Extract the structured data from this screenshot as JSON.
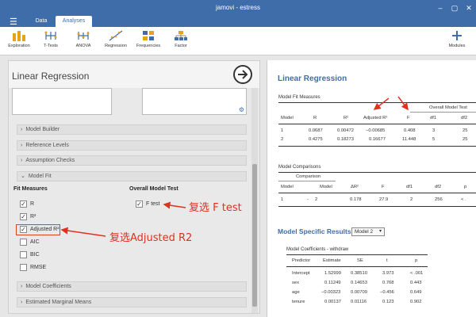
{
  "window": {
    "title": "jamovi - estress"
  },
  "ribbon": {
    "tabs": [
      "Data",
      "Analyses"
    ],
    "tools": [
      {
        "label": "Exploration",
        "icon": "exploration-icon"
      },
      {
        "label": "T-Tests",
        "icon": "t-tests-icon"
      },
      {
        "label": "ANOVA",
        "icon": "anova-icon"
      },
      {
        "label": "Regression",
        "icon": "regression-icon"
      },
      {
        "label": "Frequencies",
        "icon": "frequencies-icon"
      },
      {
        "label": "Factor",
        "icon": "factor-icon"
      }
    ],
    "modules_label": "Modules"
  },
  "left": {
    "title": "Linear Regression",
    "sections": [
      "Model Builder",
      "Reference Levels",
      "Assumption Checks",
      "Model Fit",
      "Model Coefficients",
      "Estimated Marginal Means"
    ],
    "fit_measures_label": "Fit Measures",
    "overall_test_label": "Overall Model Test",
    "measures": [
      {
        "label": "R",
        "checked": true
      },
      {
        "label": "R²",
        "checked": true
      },
      {
        "label": "Adjusted R²",
        "checked": true
      },
      {
        "label": "AIC",
        "checked": false
      },
      {
        "label": "BIC",
        "checked": false
      },
      {
        "label": "RMSE",
        "checked": false
      }
    ],
    "ftest": {
      "label": "F test",
      "checked": true
    }
  },
  "annotations": {
    "ftest": "复选 F test",
    "adjr2": "复选Adjusted R2"
  },
  "results": {
    "title": "Linear Regression",
    "fit": {
      "title": "Model Fit Measures",
      "overall_header": "Overall Model Test",
      "headers": [
        "Model",
        "R",
        "R²",
        "Adjusted R²",
        "F",
        "df1",
        "df2"
      ],
      "rows": [
        [
          "1",
          "0.0687",
          "0.00472",
          "−0.00685",
          "0.408",
          "3",
          "25"
        ],
        [
          "2",
          "0.4275",
          "0.18273",
          "0.16677",
          "11.448",
          "5",
          "25"
        ]
      ]
    },
    "comparison": {
      "title": "Model Comparisons",
      "group_header": "Comparison",
      "headers": [
        "Model",
        "",
        "Model",
        "ΔR²",
        "F",
        "df1",
        "df2",
        "p"
      ],
      "row": [
        "1",
        "-",
        "2",
        "0.178",
        "27.9",
        "2",
        "256",
        "< ."
      ]
    },
    "specific": {
      "title": "Model Specific Results",
      "selected": "Model 2"
    },
    "coef": {
      "title": "Model Coefficients - withdraw",
      "headers": [
        "Predictor",
        "Estimate",
        "SE",
        "t",
        "p"
      ],
      "rows": [
        [
          "Intercept",
          "1.52999",
          "0.38510",
          "3.973",
          "< .001"
        ],
        [
          "sex",
          "0.11249",
          "0.14653",
          "0.768",
          "0.443"
        ],
        [
          "age",
          "−0.00323",
          "0.00709",
          "−0.456",
          "0.649"
        ],
        [
          "tenure",
          "0.00137",
          "0.01116",
          "0.123",
          "0.902"
        ]
      ]
    }
  },
  "colors": {
    "brand": "#3e6da9",
    "annotation": "#e0301e"
  }
}
